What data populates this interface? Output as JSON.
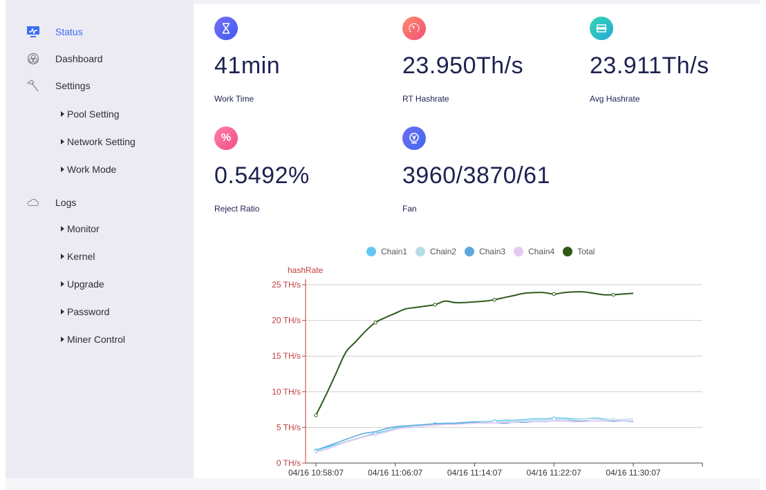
{
  "sidebar": {
    "items": [
      {
        "label": "Status",
        "icon": "monitor-icon",
        "active": true
      },
      {
        "label": "Dashboard",
        "icon": "dashboard-icon"
      },
      {
        "label": "Settings",
        "icon": "hammer-icon"
      },
      {
        "label": "Logs",
        "icon": "cloud-icon"
      }
    ],
    "settings_sub": [
      "Pool Setting",
      "Network Setting",
      "Work Mode"
    ],
    "logs_sub": [
      "Monitor",
      "Kernel",
      "Upgrade",
      "Password",
      "Miner Control"
    ]
  },
  "stats": [
    {
      "value": "41min",
      "label": "Work Time",
      "icon": "hourglass-icon",
      "color": "#5a5cf2"
    },
    {
      "value": "23.950Th/s",
      "label": "RT Hashrate",
      "icon": "speedometer-icon",
      "color": "#f36a6a"
    },
    {
      "value": "23.911Th/s",
      "label": "Avg Hashrate",
      "icon": "chip-icon",
      "color": "#2fc6b9"
    },
    {
      "value": "0.5492%",
      "label": "Reject Ratio",
      "icon": "percent-icon",
      "color": "#f25a8d"
    },
    {
      "value": "3960/3870/61",
      "label": "Fan",
      "icon": "fan-icon",
      "color": "#5469ee"
    }
  ],
  "chart_data": {
    "type": "line",
    "ylabel": "hashRate",
    "ylim": [
      0,
      25
    ],
    "y_ticks": [
      "0 TH/s",
      "5 TH/s",
      "10 TH/s",
      "15 TH/s",
      "20 TH/s",
      "25 TH/s"
    ],
    "y_tick_values": [
      0,
      5,
      10,
      15,
      20,
      25
    ],
    "x_start_label": "04/16 10:58:07",
    "x_ticks": [
      "04/16 10:58:07",
      "04/16 11:06:07",
      "04/16 11:14:07",
      "04/16 11:22:07",
      "04/16 11:30:07"
    ],
    "x": [
      "04/16 10:58:07",
      "04/16 10:59:07",
      "04/16 11:00:07",
      "04/16 11:01:07",
      "04/16 11:02:07",
      "04/16 11:03:07",
      "04/16 11:04:07",
      "04/16 11:05:07",
      "04/16 11:06:07",
      "04/16 11:07:07",
      "04/16 11:08:07",
      "04/16 11:09:07",
      "04/16 11:10:07",
      "04/16 11:11:07",
      "04/16 11:12:07",
      "04/16 11:13:07",
      "04/16 11:14:07",
      "04/16 11:15:07",
      "04/16 11:16:07",
      "04/16 11:17:07",
      "04/16 11:18:07",
      "04/16 11:19:07",
      "04/16 11:20:07",
      "04/16 11:21:07",
      "04/16 11:22:07",
      "04/16 11:23:07",
      "04/16 11:24:07",
      "04/16 11:25:07",
      "04/16 11:26:07",
      "04/16 11:27:07",
      "04/16 11:28:07",
      "04/16 11:29:07",
      "04/16 11:30:07"
    ],
    "series": [
      {
        "name": "Chain1",
        "color": "#63c8f0",
        "values": [
          1.8,
          2.2,
          2.6,
          3.0,
          3.4,
          3.8,
          4.2,
          4.5,
          4.9,
          5.1,
          5.3,
          5.4,
          5.5,
          5.6,
          5.6,
          5.7,
          5.8,
          5.8,
          5.9,
          6.0,
          6.0,
          6.1,
          6.2,
          6.2,
          6.3,
          6.3,
          6.2,
          6.2,
          6.3,
          6.2,
          6.0,
          5.9,
          5.9
        ]
      },
      {
        "name": "Chain2",
        "color": "#b7dde7",
        "values": [
          1.6,
          2.0,
          2.5,
          3.0,
          3.4,
          3.8,
          4.0,
          4.4,
          4.8,
          5.0,
          5.1,
          5.3,
          5.4,
          5.5,
          5.5,
          5.6,
          5.7,
          5.7,
          5.8,
          5.8,
          5.9,
          5.9,
          6.0,
          6.0,
          6.1,
          6.1,
          6.1,
          6.2,
          6.2,
          6.1,
          6.1,
          6.1,
          6.2
        ]
      },
      {
        "name": "Chain3",
        "color": "#5aa8dd",
        "values": [
          1.8,
          2.3,
          2.8,
          3.3,
          3.8,
          4.2,
          4.4,
          4.8,
          5.1,
          5.2,
          5.3,
          5.4,
          5.5,
          5.5,
          5.6,
          5.6,
          5.7,
          5.6,
          5.6,
          5.6,
          5.7,
          5.7,
          5.8,
          5.8,
          5.9,
          5.9,
          5.9,
          5.9,
          5.9,
          5.9,
          5.9,
          5.9,
          5.8
        ]
      },
      {
        "name": "Chain4",
        "color": "#e6c9f5",
        "values": [
          1.5,
          1.9,
          2.4,
          2.9,
          3.3,
          3.7,
          4.0,
          4.3,
          4.7,
          4.9,
          5.0,
          5.2,
          5.3,
          5.4,
          5.4,
          5.5,
          5.6,
          5.6,
          5.6,
          5.7,
          5.7,
          5.8,
          5.8,
          5.8,
          5.9,
          5.9,
          5.8,
          5.8,
          5.9,
          5.9,
          6.0,
          5.9,
          5.9
        ]
      },
      {
        "name": "Total",
        "color": "#2d5a17",
        "values": [
          6.7,
          9.5,
          12.5,
          15.5,
          17.0,
          18.5,
          19.7,
          20.4,
          21.0,
          21.6,
          21.8,
          22.0,
          22.2,
          22.7,
          22.5,
          22.5,
          22.6,
          22.7,
          22.9,
          23.2,
          23.5,
          23.8,
          23.9,
          23.9,
          23.7,
          23.9,
          24.0,
          24.0,
          23.8,
          23.6,
          23.6,
          23.7,
          23.8
        ]
      }
    ],
    "markers": {
      "Total": [
        0,
        6,
        12,
        18,
        24,
        30
      ],
      "Chain1": [
        0,
        6,
        12,
        18,
        24,
        30
      ],
      "Chain2": [
        0,
        6,
        12,
        18,
        24,
        30
      ]
    },
    "grid": true,
    "legend_position": "top"
  }
}
